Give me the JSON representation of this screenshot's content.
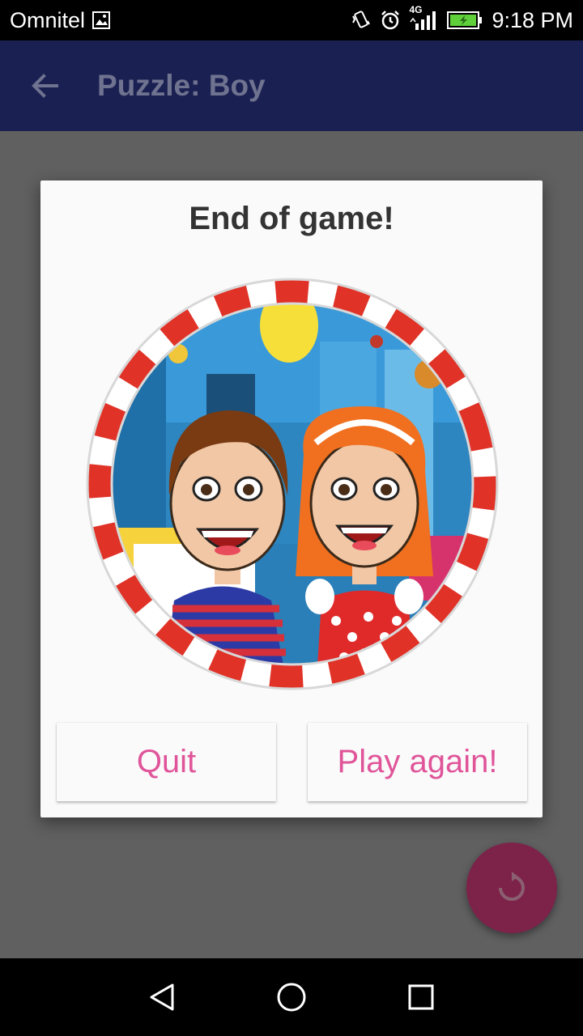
{
  "status_bar": {
    "carrier": "Omnitel",
    "network": "4G",
    "time": "9:18 PM",
    "icons": [
      "image-notification-icon",
      "vibrate-icon",
      "alarm-icon",
      "signal-icon",
      "battery-charging-icon"
    ]
  },
  "app_bar": {
    "back_icon": "arrow-back-icon",
    "title": "Puzzle: Boy"
  },
  "dialog": {
    "title": "End of game!",
    "image": "boy-and-girl-medallion",
    "buttons": {
      "quit": "Quit",
      "play_again": "Play again!"
    }
  },
  "fab": {
    "icon": "replay-icon"
  },
  "nav_bar": {
    "icons": [
      "back-triangle-icon",
      "home-circle-icon",
      "recents-square-icon"
    ]
  },
  "colors": {
    "status_bar": "#000000",
    "app_bar_dimmed": "#1a2152",
    "scrim_background": "#606060",
    "dialog_background": "#fafafa",
    "button_text": "#e0559a",
    "fab_dimmed": "#7d2249"
  }
}
